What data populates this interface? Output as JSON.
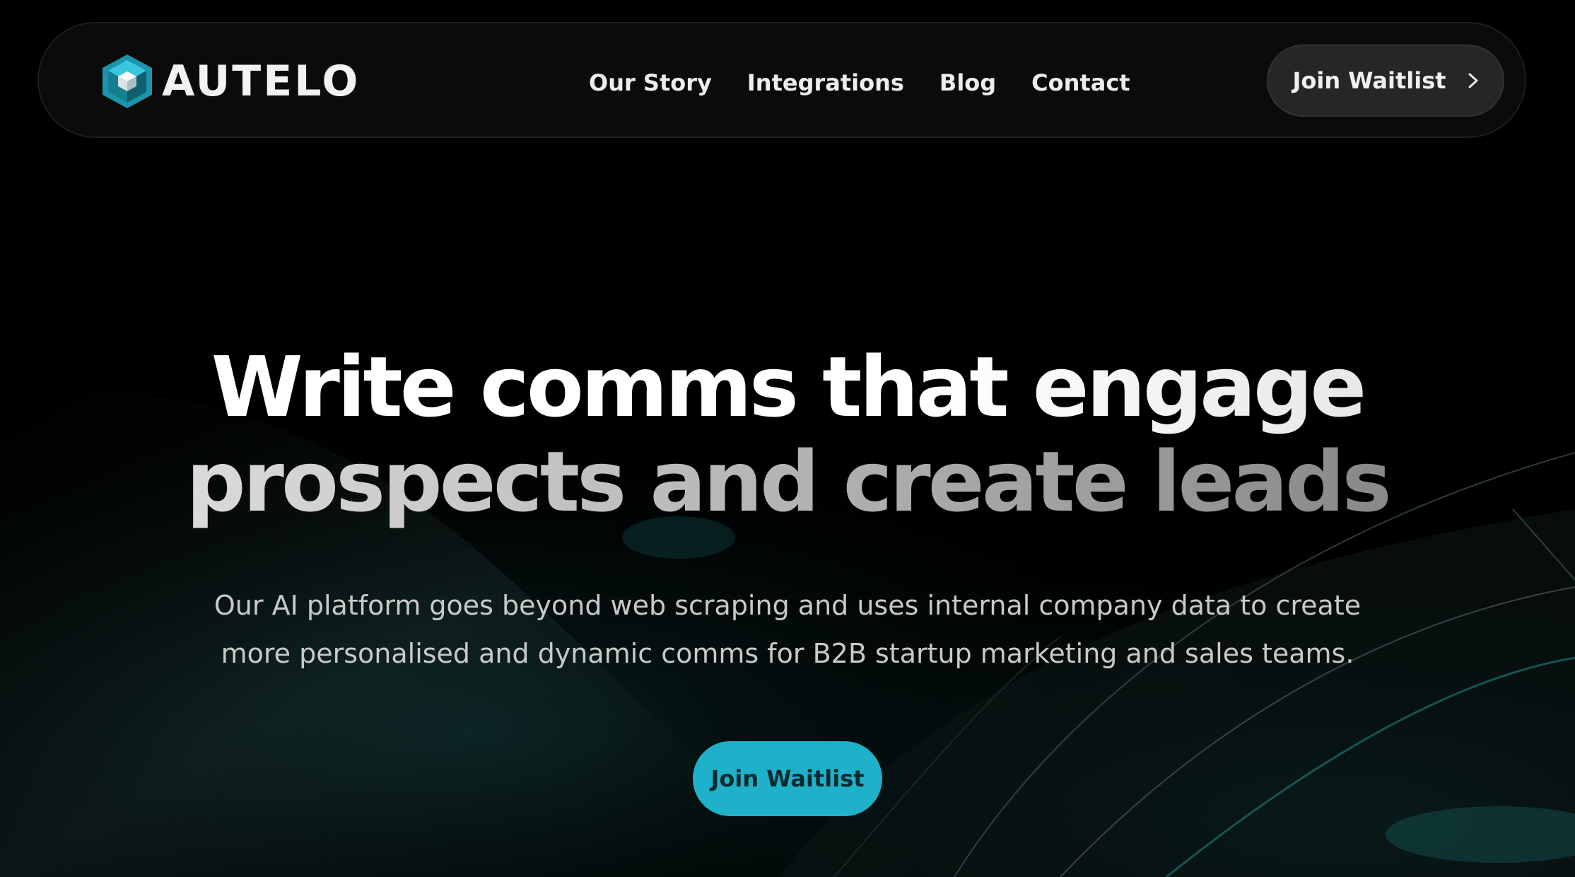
{
  "brand": {
    "name": "AUTELO",
    "accent_color": "#1fb1c9"
  },
  "nav": {
    "links": [
      "Our Story",
      "Integrations",
      "Blog",
      "Contact"
    ],
    "cta_label": "Join Waitlist",
    "cta_icon": "chevron-right-icon"
  },
  "hero": {
    "title_line_1": "Write comms that engage",
    "title_line_2": "prospects and create leads",
    "subtitle": "Our AI platform goes beyond web scraping and uses internal company data to create more personalised and dynamic comms for B2B startup marketing and sales teams.",
    "cta_label": "Join Waitlist"
  }
}
